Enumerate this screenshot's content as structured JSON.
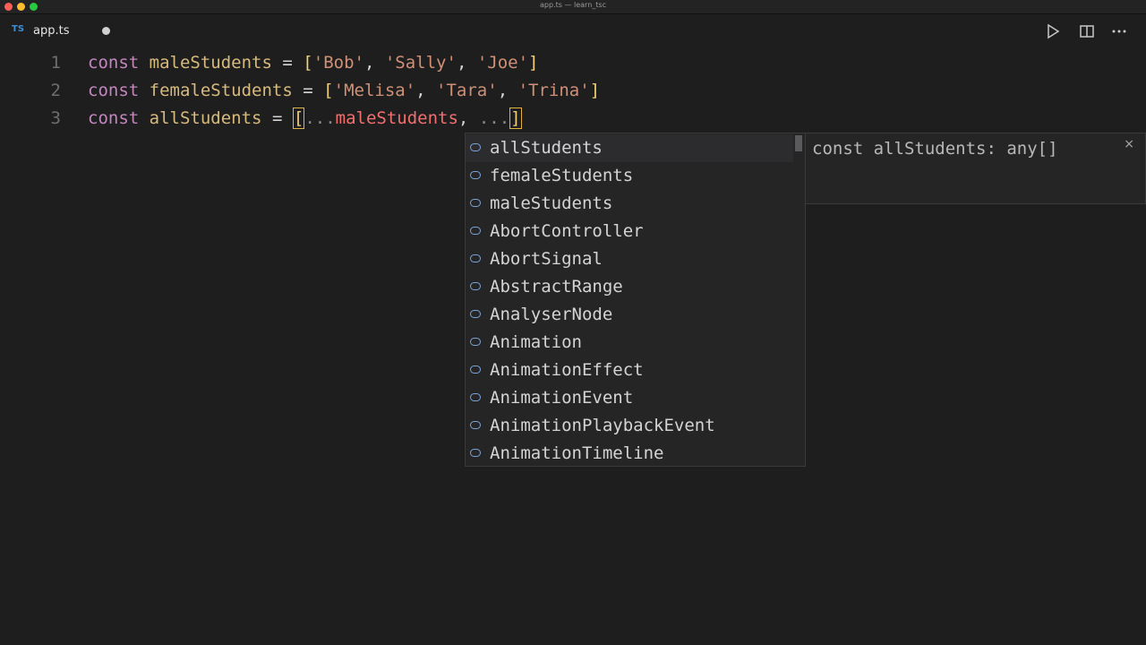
{
  "window": {
    "title": "app.ts — learn_tsc"
  },
  "tab": {
    "icon": "TS",
    "filename": "app.ts"
  },
  "actions": [
    {
      "name": "run-icon"
    },
    {
      "name": "split-editor-icon"
    },
    {
      "name": "more-actions-icon"
    }
  ],
  "editor": {
    "lines": [
      {
        "number": "1"
      },
      {
        "number": "2"
      },
      {
        "number": "3"
      }
    ],
    "line1": {
      "kw": "const",
      "id": "maleStudents",
      "eq": "=",
      "open": "[",
      "s1": "'Bob'",
      "c1": ",",
      "s2": "'Sally'",
      "c2": ",",
      "s3": "'Joe'",
      "close": "]"
    },
    "line2": {
      "kw": "const",
      "id": "femaleStudents",
      "eq": "=",
      "open": "[",
      "s1": "'Melisa'",
      "c1": ",",
      "s2": "'Tara'",
      "c2": ",",
      "s3": "'Trina'",
      "close": "]"
    },
    "line3": {
      "kw": "const",
      "id": "allStudents",
      "eq": "=",
      "open": "[",
      "spread1": "...",
      "ref1": "maleStudents",
      "c1": ",",
      "spread2": "...",
      "close": "]"
    }
  },
  "suggest": {
    "items": [
      "allStudents",
      "femaleStudents",
      "maleStudents",
      "AbortController",
      "AbortSignal",
      "AbstractRange",
      "AnalyserNode",
      "Animation",
      "AnimationEffect",
      "AnimationEvent",
      "AnimationPlaybackEvent",
      "AnimationTimeline"
    ],
    "detail": "const allStudents: any[]",
    "close": "×"
  },
  "colors": {
    "keyword": "#c586c0",
    "identifier": "#d7ba7d",
    "string": "#ce9178",
    "bracket": "#f0d078",
    "error": "#f07070",
    "background": "#1e1e1e"
  }
}
